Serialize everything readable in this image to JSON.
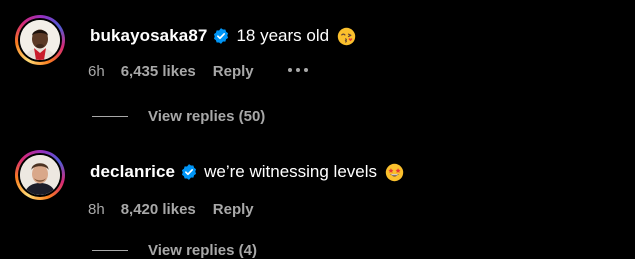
{
  "comments": [
    {
      "username": "bukayosaka87",
      "text": "18 years old",
      "emoji_icon": "face-blowing-kiss-emoji",
      "time": "6h",
      "likes": "6,435 likes",
      "reply_label": "Reply"
    },
    {
      "username": "declanrice",
      "text": "we’re witnessing levels",
      "emoji_icon": "star-struck-emoji",
      "time": "8h",
      "likes": "8,420 likes",
      "reply_label": "Reply"
    }
  ],
  "view_replies": {
    "label": "View replies (50)"
  },
  "view_replies_2": {
    "label": "View replies (4)"
  },
  "colors": {
    "background": "#000000",
    "primary_text": "#ffffff",
    "secondary_text": "#a8a8a8",
    "verified": "#0095f6"
  }
}
